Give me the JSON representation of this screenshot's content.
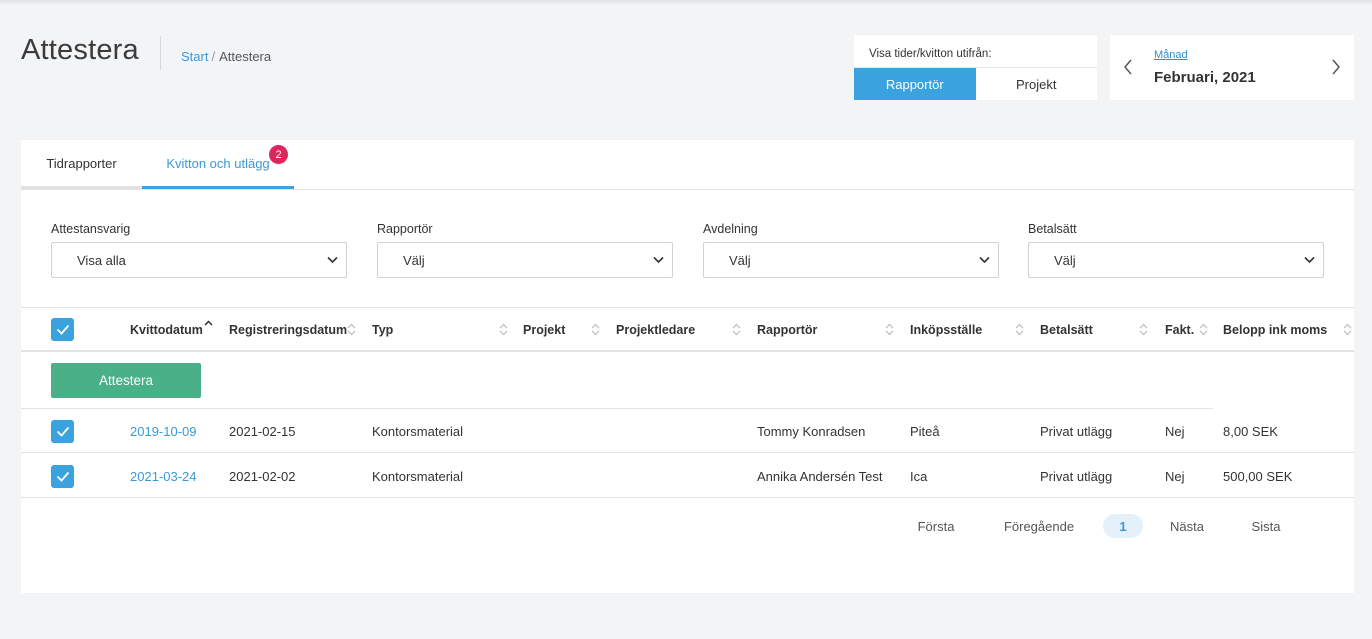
{
  "header": {
    "title": "Attestera",
    "breadcrumb": {
      "home": "Start",
      "separator": "/",
      "current": "Attestera"
    }
  },
  "view_toggle": {
    "label": "Visa tider/kvitton utifrån:",
    "options": [
      "Rapportör",
      "Projekt"
    ],
    "active": "Rapportör"
  },
  "period": {
    "mode": "Månad",
    "value": "Februari, 2021",
    "prev_icon": "chevron-left-icon",
    "next_icon": "chevron-right-icon"
  },
  "tabs": [
    {
      "label": "Tidrapporter",
      "active": false
    },
    {
      "label": "Kvitton och utlägg",
      "active": true,
      "badge": "2"
    }
  ],
  "filters": [
    {
      "label": "Attestansvarig",
      "value": "Visa alla"
    },
    {
      "label": "Rapportör",
      "value": "Välj"
    },
    {
      "label": "Avdelning",
      "value": "Välj"
    },
    {
      "label": "Betalsätt",
      "value": "Välj"
    }
  ],
  "table": {
    "columns": [
      "Kvittodatum",
      "Registreringsdatum",
      "Typ",
      "Projekt",
      "Projektledare",
      "Rapportör",
      "Inköpsställe",
      "Betalsätt",
      "Fakt.",
      "Belopp ink moms"
    ],
    "rows": [
      {
        "kvittodatum": "2019-10-09",
        "registreringsdatum": "2021-02-15",
        "typ": "Kontorsmaterial",
        "projekt": "",
        "projektledare": "",
        "rapportor": "Tommy Konradsen",
        "inkopsstalle": "Piteå",
        "betalsatt": "Privat utlägg",
        "fakt": "Nej",
        "belopp": "8,00 SEK",
        "checked": true
      },
      {
        "kvittodatum": "2021-03-24",
        "registreringsdatum": "2021-02-02",
        "typ": "Kontorsmaterial",
        "projekt": "",
        "projektledare": "",
        "rapportor": "Annika Andersén Test",
        "inkopsstalle": "Ica",
        "betalsatt": "Privat utlägg",
        "fakt": "Nej",
        "belopp": "500,00 SEK",
        "checked": true
      }
    ],
    "attest_button": "Attestera"
  },
  "pagination": {
    "first": "Första",
    "prev": "Föregående",
    "current": "1",
    "next": "Nästa",
    "last": "Sista"
  },
  "colors": {
    "accent": "#3aa2de",
    "link": "#3a9ad9",
    "attest_button": "#49b087",
    "badge": "#e0245e"
  }
}
